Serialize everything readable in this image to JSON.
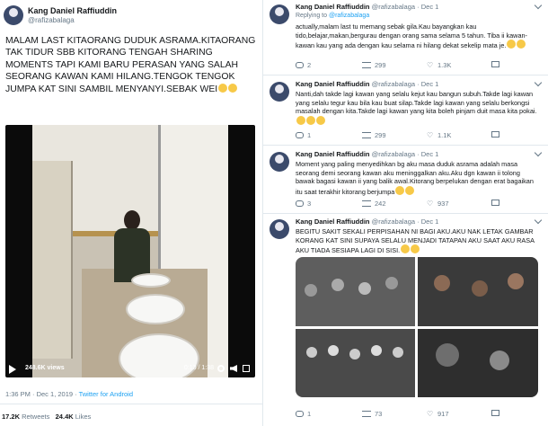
{
  "main_tweet": {
    "author_name": "Kang Daniel Raffiuddin",
    "author_handle": "@rafizabalaga",
    "text": "MALAM LAST KITAORANG DUDUK ASRAMA.KITAORANG TAK TIDUR SBB KITORANG TENGAH SHARING MOMENTS TAPI KAMI BARU PERASAN YANG SALAH SEORANG KAWAN KAMI HILANG.TENGOK TENGOK JUMPA KAT SINI SAMBIL MENYANYI.SEBAK WEI",
    "video": {
      "views": "248.6K views",
      "time": "0:13 / 1:38"
    },
    "timestamp": "1:36 PM · Dec 1, 2019 · ",
    "source": "Twitter for Android",
    "retweets_count": "17.2K",
    "retweets_label": "Retweets",
    "likes_count": "24.4K",
    "likes_label": "Likes"
  },
  "replies": [
    {
      "author_name": "Kang Daniel Raffiuddin",
      "author_handle": "@rafizabalaga",
      "date": "· Dec 1",
      "replying_label": "Replying to ",
      "replying_to": "@rafizabalaga",
      "text": "actually,malam last tu memang sebak gila.Kau bayangkan kau tido,belajar,makan,bergurau dengan orang sama selama 5 tahun. Tiba ii kawan-kawan kau yang ada dengan kau selama ni hilang dekat sekelip mata je.",
      "replies": "2",
      "retweets": "299",
      "likes": "1.3K"
    },
    {
      "author_name": "Kang Daniel Raffiuddin",
      "author_handle": "@rafizabalaga",
      "date": "· Dec 1",
      "text": "Nanti,dah takde lagi kawan yang selalu kejut kau bangun subuh.Takde lagi kawan yang selalu tegur kau bila kau buat silap.Takde lagi kawan yang selalu berkongsi masalah dengan kita.Takde lagi kawan yang kita boleh pinjam duit masa kita pokai.",
      "replies": "1",
      "retweets": "299",
      "likes": "1.1K"
    },
    {
      "author_name": "Kang Daniel Raffiuddin",
      "author_handle": "@rafizabalaga",
      "date": "· Dec 1",
      "text": "Moment yang paling menyedihkan bg aku masa duduk asrama adalah masa seorang demi seorang kawan aku meninggalkan aku.Aku dgn kawan ii tolong bawak bagasi kawan ii yang balik awal.Kitorang berpelukan dengan erat bagaikan itu saat terakhir kitorang berjumpa",
      "replies": "3",
      "retweets": "242",
      "likes": "937"
    },
    {
      "author_name": "Kang Daniel Raffiuddin",
      "author_handle": "@rafizabalaga",
      "date": "· Dec 1",
      "text": "BEGITU SAKIT SEKALI PERPISAHAN NI BAGI AKU.AKU NAK LETAK GAMBAR KORANG KAT SINI SUPAYA SELALU MENJADI TATAPAN AKU SAAT AKU RASA AKU TIADA SESIAPA LAGI DI SISI.",
      "replies": "1",
      "retweets": "73",
      "likes": "917"
    }
  ],
  "colors": {
    "accent": "#1da1f2",
    "muted": "#657786",
    "text": "#14171a"
  }
}
